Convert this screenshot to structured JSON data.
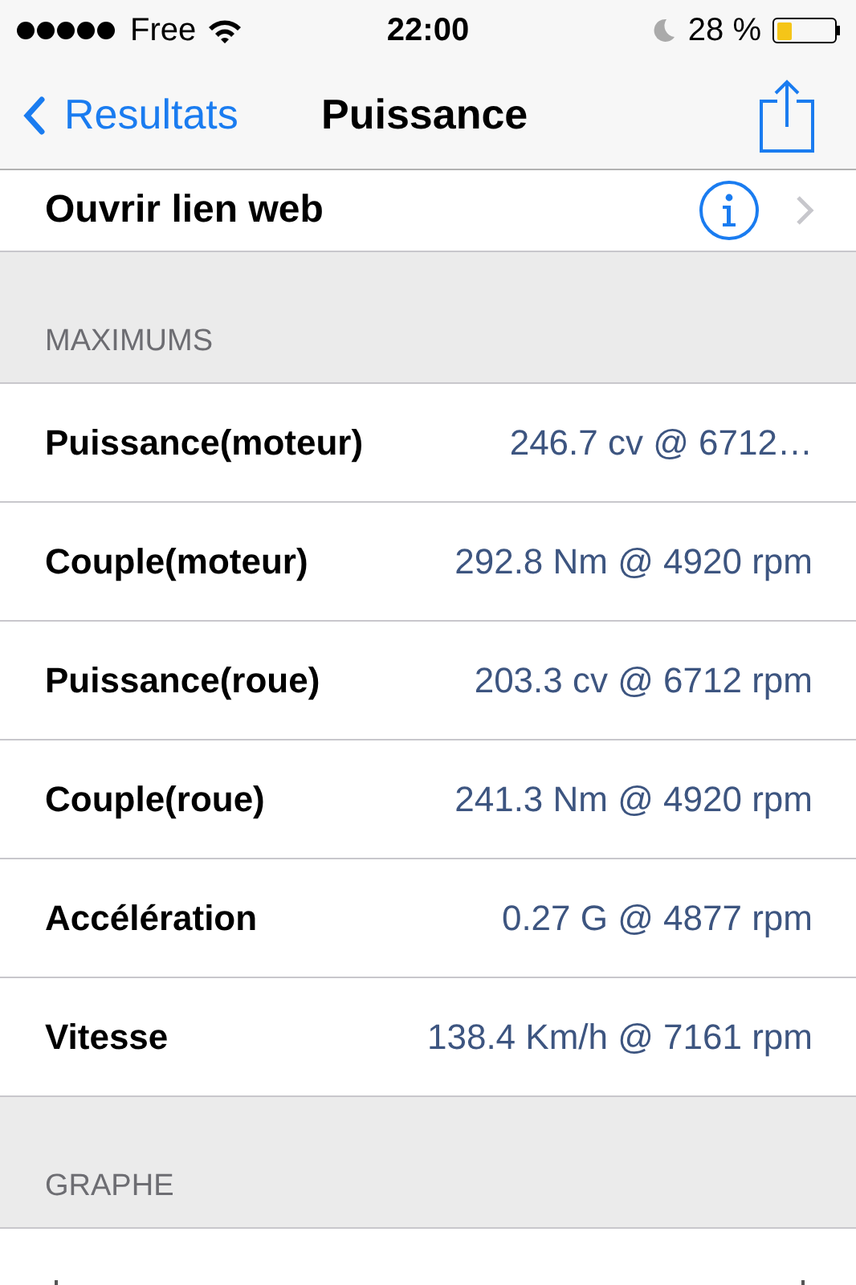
{
  "status_bar": {
    "carrier": "Free",
    "time": "22:00",
    "battery_percent": "28 %",
    "battery": {
      "level": 0.28
    }
  },
  "nav": {
    "back": "Resultats",
    "title": "Puissance"
  },
  "link_row": {
    "label": "Ouvrir lien web"
  },
  "sections": [
    {
      "header": "MAXIMUMS",
      "rows": [
        {
          "label": "Puissance(moteur)",
          "value": "246.7 cv @ 6712…"
        },
        {
          "label": "Couple(moteur)",
          "value": "292.8 Nm @ 4920 rpm"
        },
        {
          "label": "Puissance(roue)",
          "value": "203.3 cv @ 6712 rpm"
        },
        {
          "label": "Couple(roue)",
          "value": "241.3 Nm @ 4920 rpm"
        },
        {
          "label": "Accélération",
          "value": "0.27 G @ 4877 rpm"
        },
        {
          "label": "Vitesse",
          "value": "138.4 Km/h @ 7161 rpm"
        }
      ]
    },
    {
      "header": "GRAPHE"
    }
  ]
}
